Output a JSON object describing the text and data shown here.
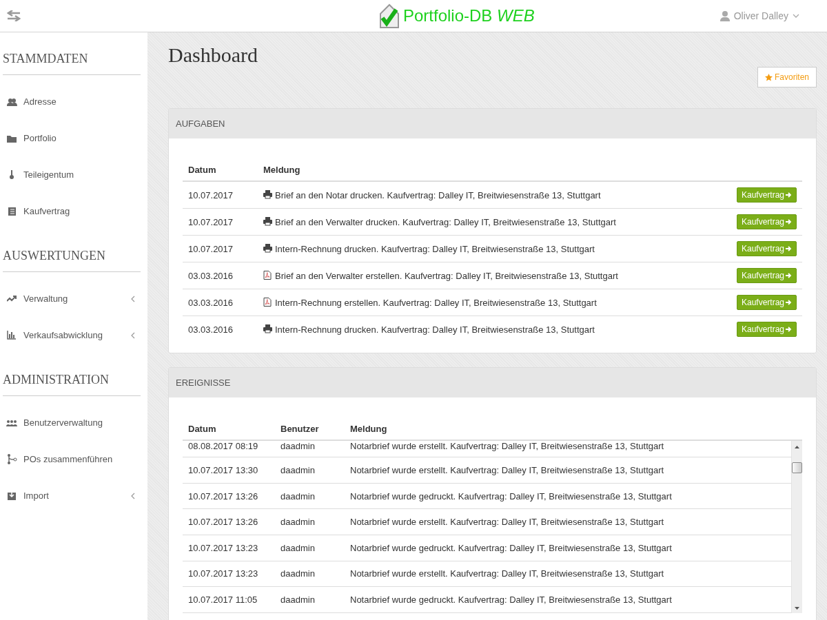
{
  "header": {
    "brand": "Portfolio-DB",
    "brand_suffix": "WEB",
    "user": "Oliver Dalley"
  },
  "sidebar": [
    {
      "heading": "STAMMDATEN",
      "items": [
        {
          "label": "Adresse",
          "expandable": false
        },
        {
          "label": "Portfolio",
          "expandable": false
        },
        {
          "label": "Teileigentum",
          "expandable": false
        },
        {
          "label": "Kaufvertrag",
          "expandable": false
        }
      ]
    },
    {
      "heading": "AUSWERTUNGEN",
      "items": [
        {
          "label": "Verwaltung",
          "expandable": true
        },
        {
          "label": "Verkaufsabwicklung",
          "expandable": true
        }
      ]
    },
    {
      "heading": "ADMINISTRATION",
      "items": [
        {
          "label": "Benutzerverwaltung",
          "expandable": false
        },
        {
          "label": "POs zusammenführen",
          "expandable": false
        },
        {
          "label": "Import",
          "expandable": true
        }
      ]
    }
  ],
  "page_title": "Dashboard",
  "favorites_button": "Favoriten",
  "tasks": {
    "title": "AUFGABEN",
    "columns": [
      "Datum",
      "Meldung"
    ],
    "rows": [
      {
        "date": "10.07.2017",
        "kind": "print",
        "message": "Brief an den Notar drucken. Kaufvertrag: Dalley IT, Breitwiesenstraße 13, Stuttgart",
        "button": "Kaufvertrag"
      },
      {
        "date": "10.07.2017",
        "kind": "print",
        "message": "Brief an den Verwalter drucken. Kaufvertrag: Dalley IT, Breitwiesenstraße 13, Stuttgart",
        "button": "Kaufvertrag"
      },
      {
        "date": "10.07.2017",
        "kind": "print",
        "message": "Intern-Rechnung drucken. Kaufvertrag: Dalley IT, Breitwiesenstraße 13, Stuttgart",
        "button": "Kaufvertrag"
      },
      {
        "date": "03.03.2016",
        "kind": "pdf",
        "message": "Brief an den Verwalter erstellen. Kaufvertrag: Dalley IT, Breitwiesenstraße 13, Stuttgart",
        "button": "Kaufvertrag"
      },
      {
        "date": "03.03.2016",
        "kind": "pdf",
        "message": "Intern-Rechnung erstellen. Kaufvertrag: Dalley IT, Breitwiesenstraße 13, Stuttgart",
        "button": "Kaufvertrag"
      },
      {
        "date": "03.03.2016",
        "kind": "print",
        "message": "Intern-Rechnung drucken. Kaufvertrag: Dalley IT, Breitwiesenstraße 13, Stuttgart",
        "button": "Kaufvertrag"
      }
    ]
  },
  "events": {
    "title": "EREIGNISSE",
    "columns": [
      "Datum",
      "Benutzer",
      "Meldung"
    ],
    "rows": [
      [
        "08.08.2017 08:19",
        "daadmin",
        "Notarbrief wurde erstellt. Kaufvertrag: Dalley IT, Breitwiesenstraße 13, Stuttgart"
      ],
      [
        "10.07.2017 13:30",
        "daadmin",
        "Notarbrief wurde erstellt. Kaufvertrag: Dalley IT, Breitwiesenstraße 13, Stuttgart"
      ],
      [
        "10.07.2017 13:26",
        "daadmin",
        "Notarbrief wurde gedruckt. Kaufvertrag: Dalley IT, Breitwiesenstraße 13, Stuttgart"
      ],
      [
        "10.07.2017 13:26",
        "daadmin",
        "Notarbrief wurde erstellt. Kaufvertrag: Dalley IT, Breitwiesenstraße 13, Stuttgart"
      ],
      [
        "10.07.2017 13:23",
        "daadmin",
        "Notarbrief wurde gedruckt. Kaufvertrag: Dalley IT, Breitwiesenstraße 13, Stuttgart"
      ],
      [
        "10.07.2017 13:23",
        "daadmin",
        "Notarbrief wurde erstellt. Kaufvertrag: Dalley IT, Breitwiesenstraße 13, Stuttgart"
      ],
      [
        "10.07.2017 11:05",
        "daadmin",
        "Notarbrief wurde gedruckt. Kaufvertrag: Dalley IT, Breitwiesenstraße 13, Stuttgart"
      ]
    ]
  }
}
